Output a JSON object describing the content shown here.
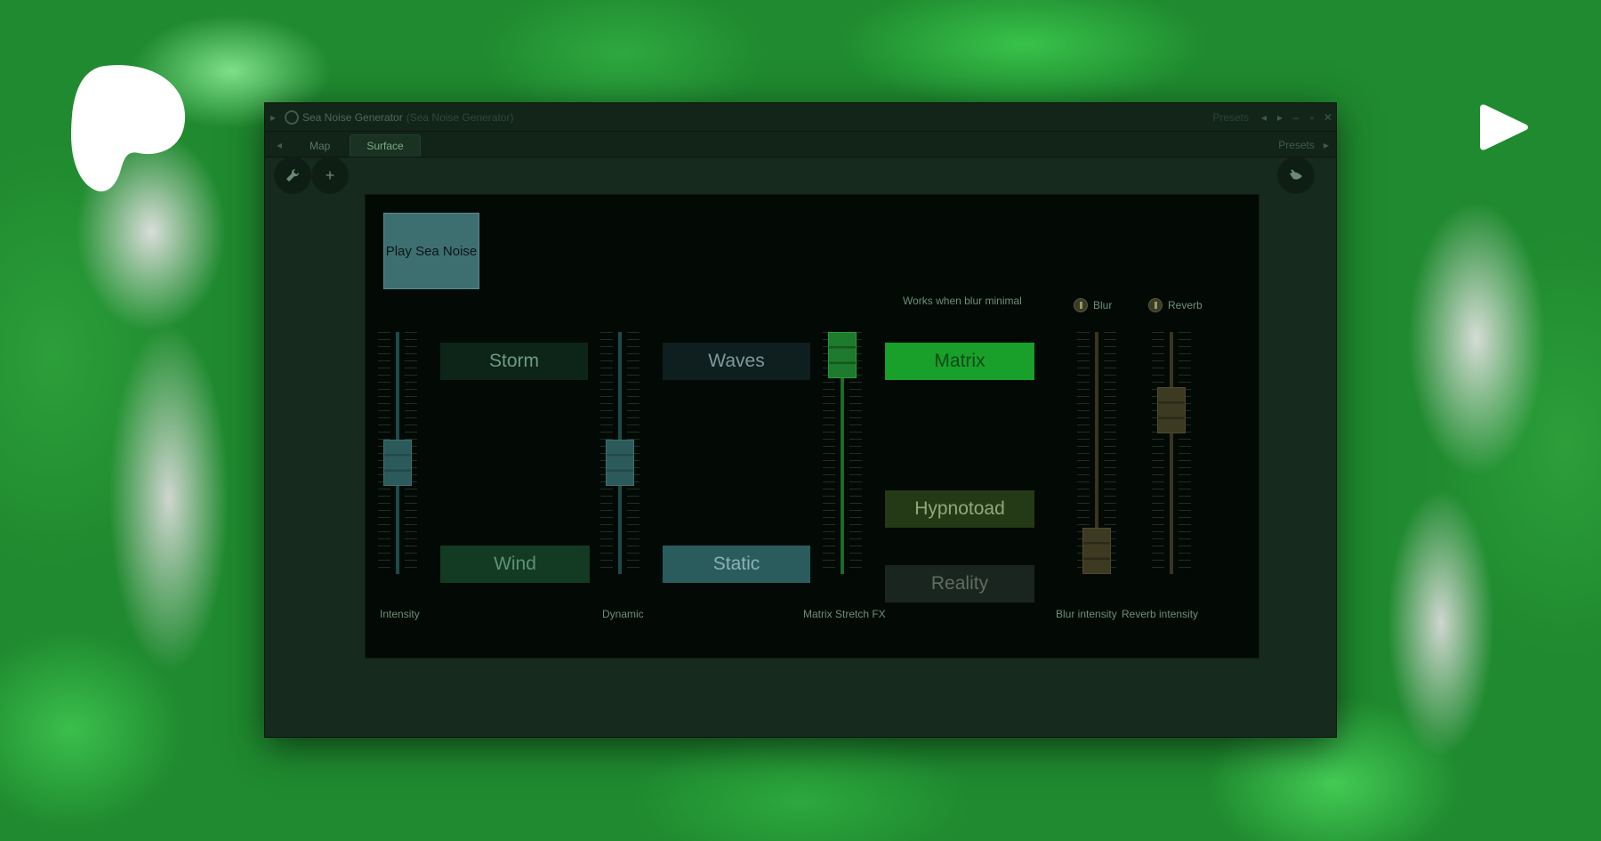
{
  "window": {
    "title": "Sea Noise Generator",
    "subtitle": "(Sea Noise Generator)",
    "presets_label": "Presets"
  },
  "tabs": [
    {
      "label": "Map",
      "active": false
    },
    {
      "label": "Surface",
      "active": true
    }
  ],
  "tabbar": {
    "presets_label": "Presets"
  },
  "toolbar": {
    "wrench_icon": "wrench-icon",
    "plus_label": "+",
    "right_icon": "fruit-icon"
  },
  "surface": {
    "play_button": "Play Sea Noise",
    "note": "Works when blur minimal",
    "pads": {
      "storm": "Storm",
      "waves": "Waves",
      "matrix": "Matrix",
      "wind": "Wind",
      "static": "Static",
      "hypnotoad": "Hypnotoad",
      "reality": "Reality"
    },
    "faders": {
      "intensity": {
        "label": "Intensity",
        "level": 0.45
      },
      "dynamic": {
        "label": "Dynamic",
        "level": 0.45
      },
      "matrix_stretch": {
        "label": "Matrix Stretch FX",
        "level": 1.0
      },
      "blur_intensity": {
        "label": "Blur intensity",
        "level": 0.0
      },
      "reverb_intensity": {
        "label": "Reverb intensity",
        "level": 0.72
      }
    },
    "toggles": {
      "blur": "Blur",
      "reverb": "Reverb"
    }
  },
  "colors": {
    "background_green": "#1f8a2f",
    "matrix_active": "#1aa52e",
    "panel": "#030a06"
  }
}
